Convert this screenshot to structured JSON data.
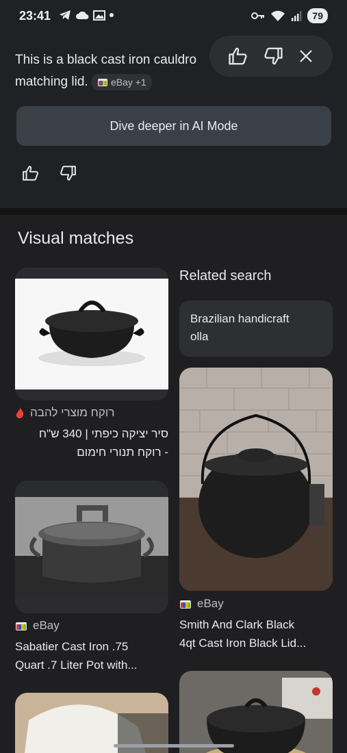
{
  "status_bar": {
    "time": "23:41",
    "battery": "79",
    "icons_left": [
      "telegram-icon",
      "cloud-icon",
      "photo-icon"
    ],
    "icons_right": [
      "key-icon",
      "wifi-icon",
      "signal-icon"
    ]
  },
  "ai_overview": {
    "text_line1": "This is a black cast iron cauldro",
    "text_line2": "matching lid.",
    "source_chip": "eBay +1",
    "ai_mode_button": "Dive deeper in AI Mode"
  },
  "visual_matches": {
    "title": "Visual matches",
    "left_column": [
      {
        "source": "רוקח מוצרי להבה",
        "title_line1": "סיר יציקה כיפתי | 340 ש\"ח",
        "title_line2": "- רוקח תנורי חימום"
      },
      {
        "source": "eBay",
        "title_line1": "Sabatier Cast Iron .75",
        "title_line2": "Quart .7 Liter Pot with..."
      }
    ],
    "related": {
      "title": "Related search",
      "chip_line1": "Brazilian handicraft",
      "chip_line2": "olla"
    },
    "right_column": [
      {
        "source": "eBay",
        "title_line1": "Smith And Clark Black",
        "title_line2": "4qt Cast Iron Black Lid..."
      }
    ]
  },
  "colors": {
    "background": "#1f1f21",
    "panel": "#202124",
    "button": "#3b3f47",
    "text": "#e8eaed",
    "muted": "#bdc1c6",
    "fire_accent": "#ea4335"
  }
}
